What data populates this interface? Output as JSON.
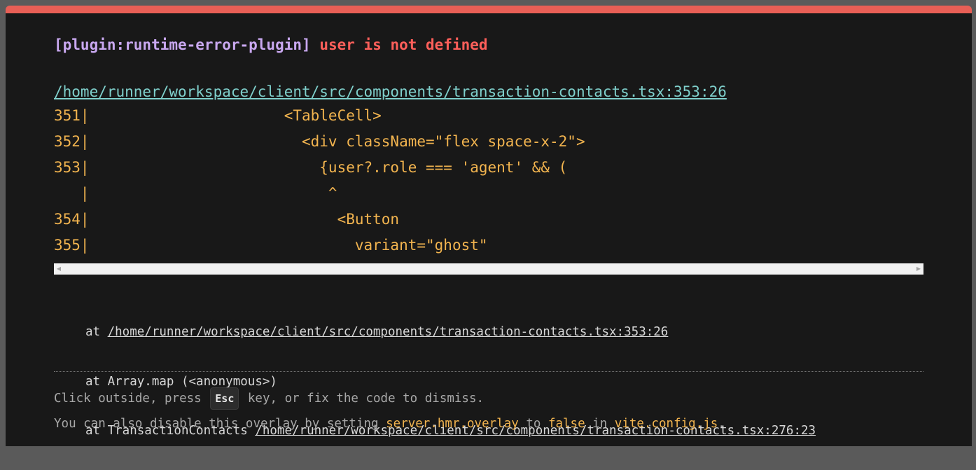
{
  "overlay": {
    "accent_color": "#e85f56",
    "plugin": "[plugin:runtime-error-plugin]",
    "message": "user is not defined",
    "file": "/home/runner/workspace/client/src/components/transaction-contacts.tsx:353:26"
  },
  "frame": {
    "lines": [
      "351|                      <TableCell>",
      "352|                        <div className=\"flex space-x-2\">",
      "353|                          {user?.role === 'agent' && (",
      "   |                           ^",
      "354|                            <Button",
      "355|                              variant=\"ghost\""
    ]
  },
  "stack": {
    "frame1_prefix": "at ",
    "frame1_link": "/home/runner/workspace/client/src/components/transaction-contacts.tsx:353:26",
    "frame2": "at Array.map (<anonymous>)",
    "frame3_prefix": "at TransactionContacts ",
    "frame3_link": "/home/runner/workspace/client/src/components/transaction-contacts.tsx:276:23"
  },
  "tip": {
    "line1_before": "Click outside, press ",
    "key": "Esc",
    "line1_after": " key, or fix the code to dismiss.",
    "line2_a": "You can also disable this overlay by setting ",
    "config_key": "server.hmr.overlay",
    "line2_b": " to ",
    "false_value": "false",
    "line2_c": " in ",
    "config_file": "vite.config.js",
    "line2_d": "."
  }
}
